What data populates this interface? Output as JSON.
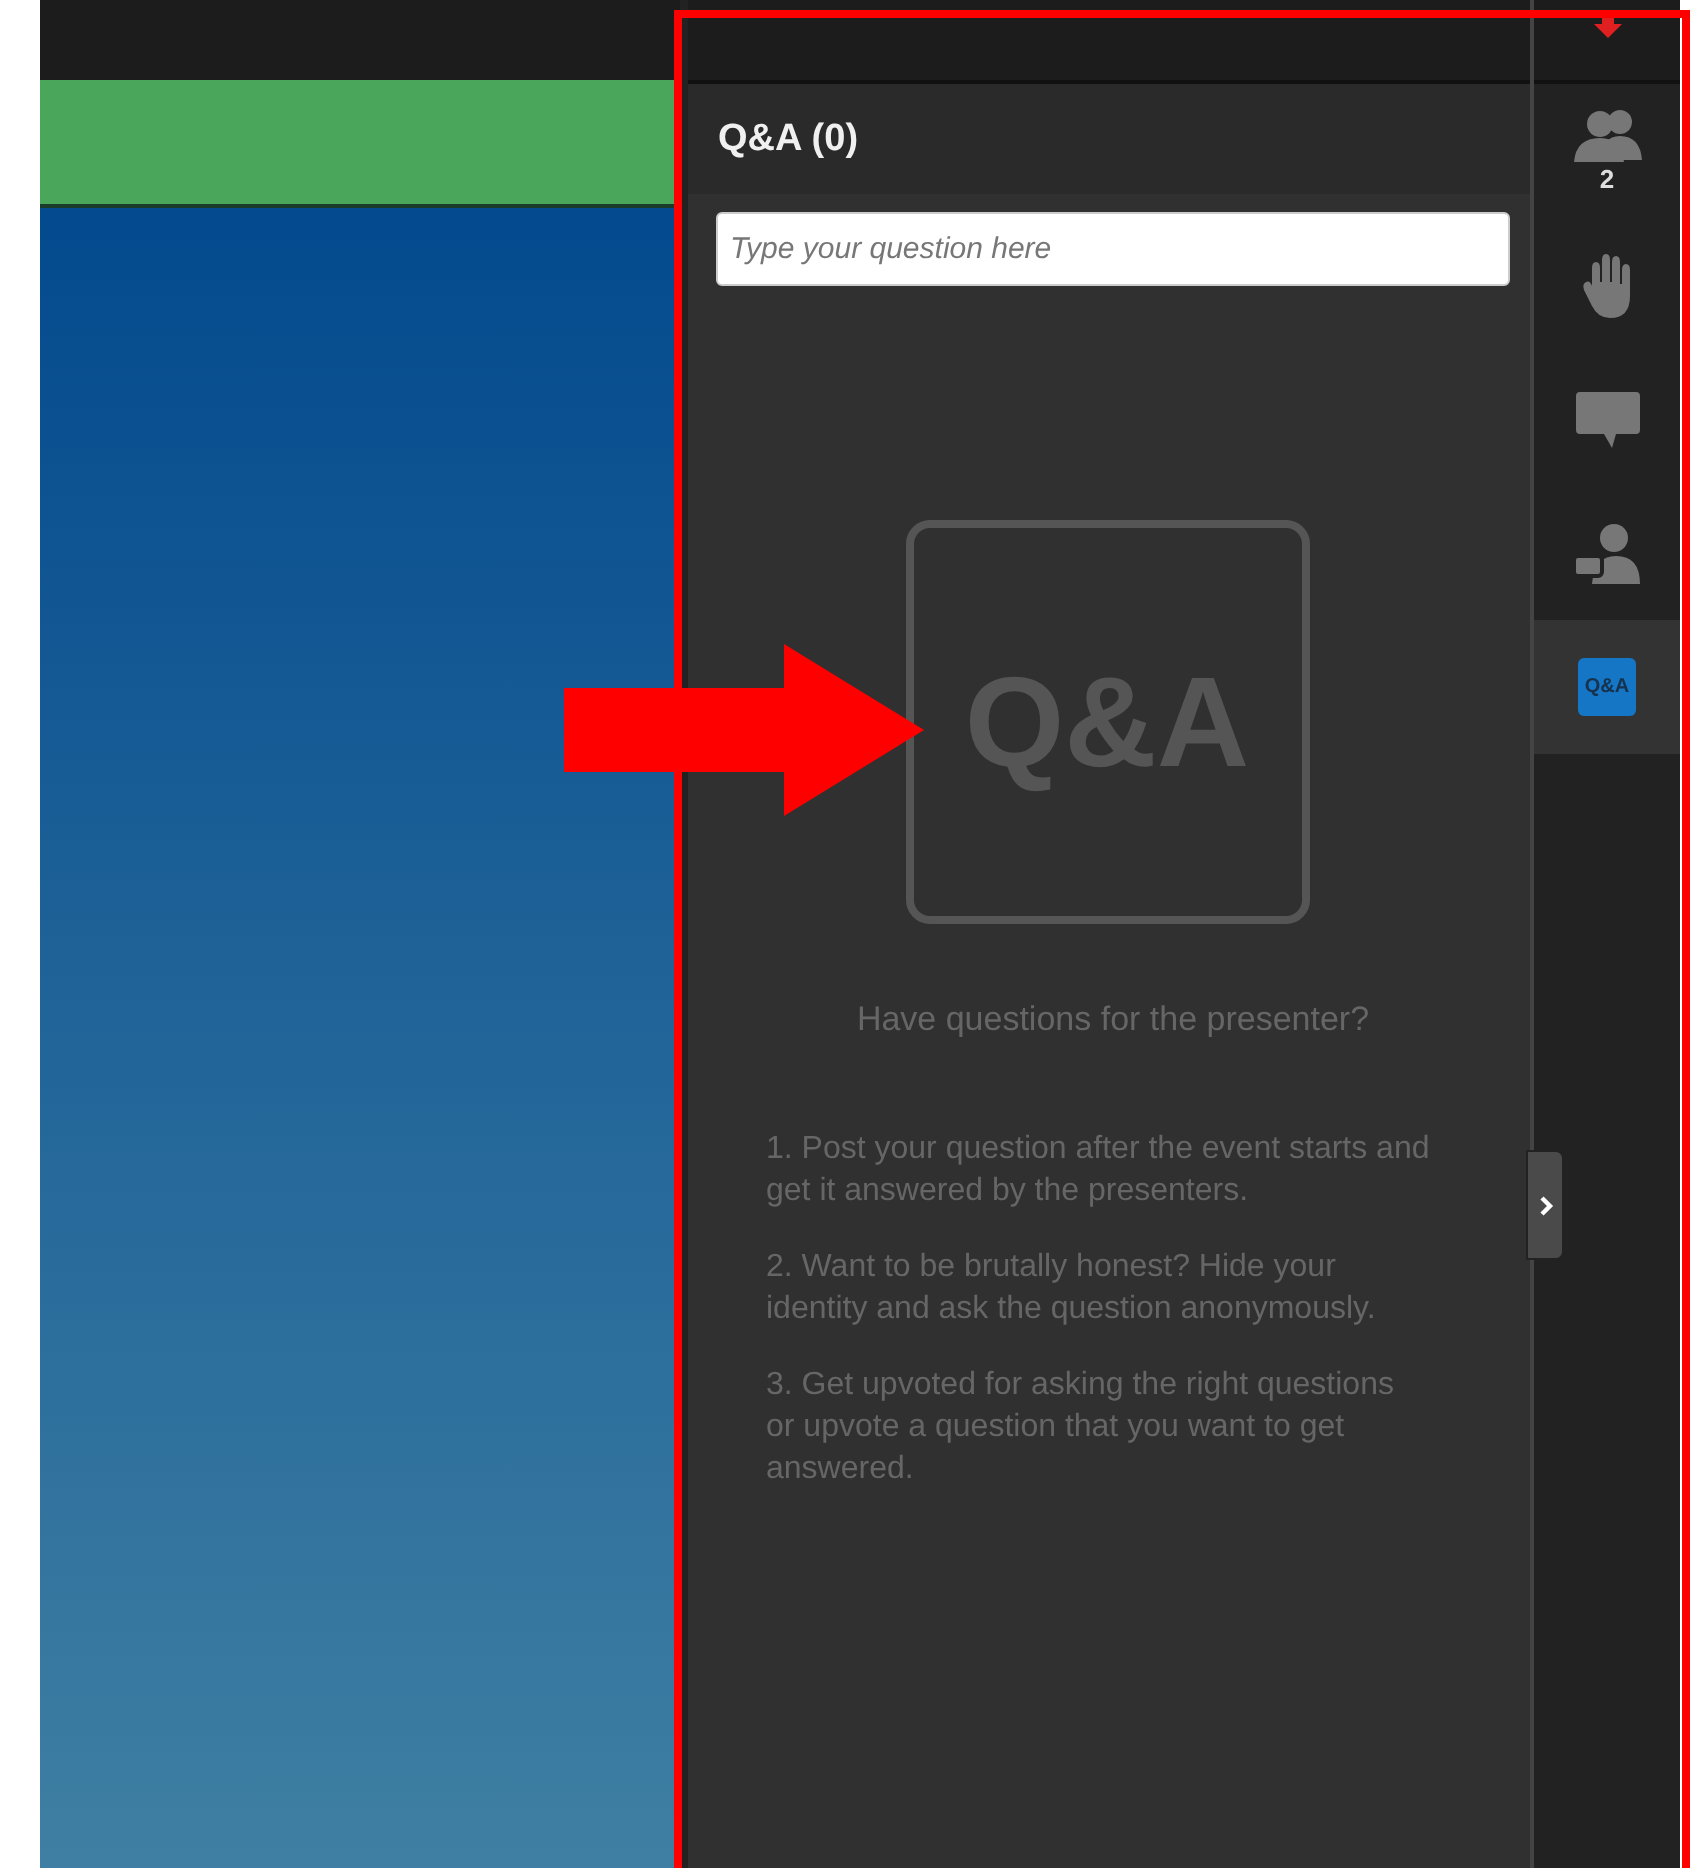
{
  "panel": {
    "title": "Q&A (0)",
    "question_field": {
      "placeholder": "Type your question here"
    },
    "logo": "Q&A",
    "heading": "Have questions for the presenter?",
    "tips": [
      "1. Post your question after the event starts and get it answered by the presenters.",
      "2. Want to be brutally honest? Hide your identity and ask the question anonymously.",
      "3. Get upvoted for asking the right questions or upvote a question that you want to get answered."
    ]
  },
  "rail": {
    "items": [
      {
        "kind": "people",
        "count": "2",
        "selected": false
      },
      {
        "kind": "hand",
        "selected": false
      },
      {
        "kind": "chat",
        "selected": false
      },
      {
        "kind": "presenter",
        "selected": false
      },
      {
        "kind": "qa",
        "label": "Q&A",
        "selected": true
      }
    ]
  }
}
